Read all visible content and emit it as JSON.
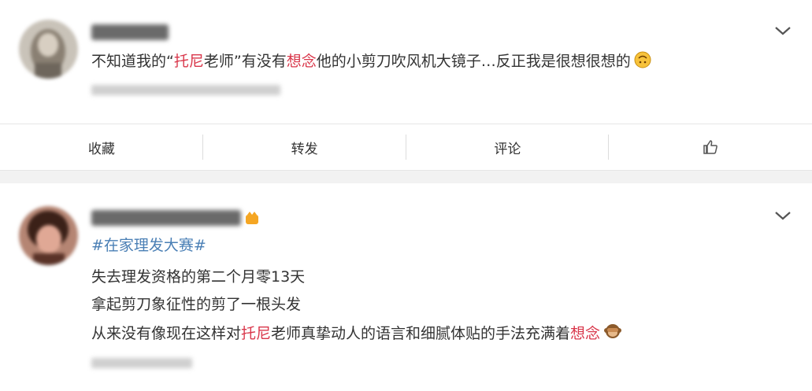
{
  "posts": [
    {
      "username_blurred": "rhUs了喵",
      "text_parts": [
        {
          "t": "不知道我的“",
          "hl": false
        },
        {
          "t": "托尼",
          "hl": true
        },
        {
          "t": "老师”有没有",
          "hl": false
        },
        {
          "t": "想念",
          "hl": true
        },
        {
          "t": "他的小剪刀吹风机大镜子…反正我是很想很想的",
          "hl": false
        }
      ],
      "emoji": "upside-down-face-icon"
    },
    {
      "username_blurred": "有的大鼻孔男孩",
      "hashtag": "#在家理发大赛#",
      "line1": "失去理发资格的第二个月零13天",
      "line2": "拿起剪刀象征性的剪了一根头发",
      "line3_parts": [
        {
          "t": "从来没有像现在这样对",
          "hl": false
        },
        {
          "t": "托尼",
          "hl": true
        },
        {
          "t": "老师真挚动人的语言和细腻体贴的手法充满着",
          "hl": false
        },
        {
          "t": "想念",
          "hl": true
        }
      ],
      "emoji": "see-no-evil-monkey-icon"
    }
  ],
  "toolbar": {
    "favorite_label": "收藏",
    "repost_label": "转发",
    "comment_label": "评论",
    "like_icon": "thumbs-up-icon"
  },
  "colors": {
    "highlight": "#d9364a",
    "hashtag": "#4a7fb5",
    "text": "#333333"
  }
}
